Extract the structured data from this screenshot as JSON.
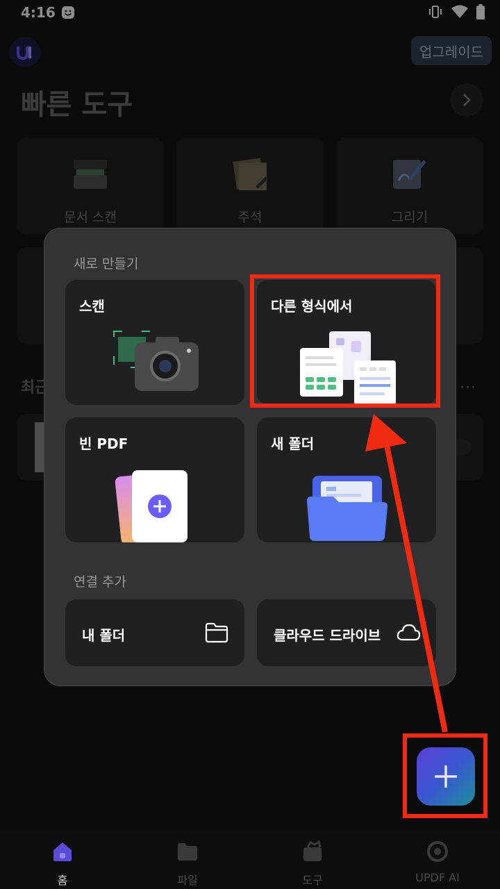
{
  "status": {
    "time": "4:16"
  },
  "header": {
    "upgrade_label": "업그레이드",
    "quick_tools_title": "빠른 도구"
  },
  "quick_tools": [
    {
      "label": "문서 스캔"
    },
    {
      "label": "주석"
    },
    {
      "label": "그리기"
    }
  ],
  "recent": {
    "title_partial": "최근",
    "more": "···"
  },
  "popup": {
    "new_section": "새로 만들기",
    "cards": {
      "scan": "스캔",
      "from_other_format": "다른 형식에서",
      "blank_pdf": "빈 PDF",
      "new_folder": "새 폴더"
    },
    "connect_section": "연결 추가",
    "connections": {
      "my_folder": "내 폴더",
      "cloud_drive": "클라우드 드라이브"
    }
  },
  "bottom_nav": [
    {
      "label": "홈",
      "active": true
    },
    {
      "label": "파일",
      "active": false
    },
    {
      "label": "도구",
      "active": false
    },
    {
      "label": "UPDF AI",
      "active": false
    }
  ],
  "colors": {
    "annotation": "#f12a12",
    "fab_gradient_start": "#5a3fd6",
    "fab_gradient_end": "#1b8f9c"
  }
}
